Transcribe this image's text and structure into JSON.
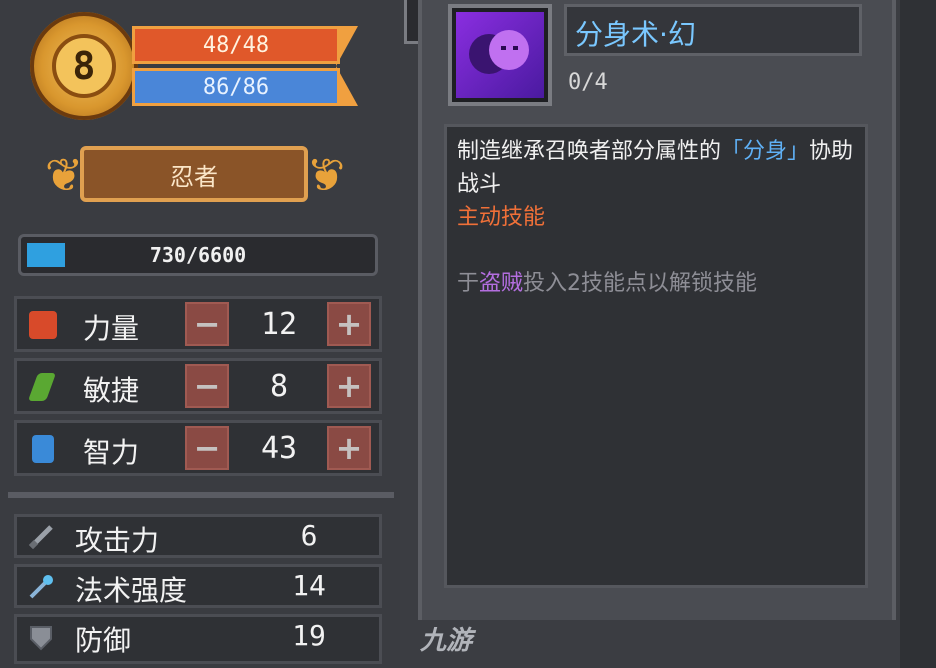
{
  "character": {
    "level": "8",
    "hp": "48/48",
    "mp": "86/86",
    "class_name": "忍者",
    "xp": "730/6600",
    "xp_progress": 0.11
  },
  "stats": [
    {
      "label": "力量",
      "value": "12",
      "icon": "fist-icon",
      "icon_color": "#d84a2a"
    },
    {
      "label": "敏捷",
      "value": "8",
      "icon": "feather-icon",
      "icon_color": "#5aa832"
    },
    {
      "label": "智力",
      "value": "43",
      "icon": "book-icon",
      "icon_color": "#3a8ad8"
    }
  ],
  "stat_buttons": {
    "minus": "−",
    "plus": "+"
  },
  "attributes": [
    {
      "label": "攻击力",
      "value": "6",
      "icon": "sword-icon"
    },
    {
      "label": "法术强度",
      "value": "14",
      "icon": "staff-icon"
    },
    {
      "label": "防御",
      "value": "19",
      "icon": "shield-icon"
    }
  ],
  "skill": {
    "name": "分身术·幻",
    "level": "0/4",
    "desc_part1": "制造继承召唤者部分属性的",
    "desc_highlight": "「分身」",
    "desc_part2": "协助战斗",
    "type": "主动技能",
    "unlock_prefix": "于",
    "unlock_class": "盗贼",
    "unlock_suffix": "投入2技能点以解锁技能"
  },
  "watermark": "九游",
  "colors": {
    "hp": "#e0582a",
    "mp": "#4a86d8",
    "xp": "#2fa0e0",
    "skill_title": "#7ac8ff",
    "skill_type": "#f07038",
    "unlock_class": "#b46ee0"
  }
}
